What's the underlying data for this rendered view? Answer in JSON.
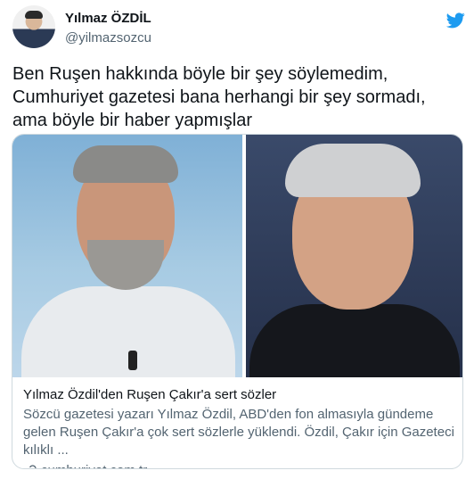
{
  "author": {
    "display_name": "Yılmaz ÖZDİL",
    "handle": "@yilmazsozcu"
  },
  "tweet": {
    "text": "Ben Ruşen hakkında böyle bir şey söylemedim, Cumhuriyet gazetesi bana herhangi bir şey sormadı, ama böyle bir haber yapmışlar"
  },
  "card": {
    "title": "Yılmaz Özdil'den Ruşen Çakır'a sert sözler",
    "description": "Sözcü gazetesi yazarı Yılmaz Özdil, ABD'den fon almasıyla gündeme gelen Ruşen Çakır'a çok sert sözlerle yüklendi. Özdil, Çakır için Gazeteci kılıklı ...",
    "domain": "cumhuriyet.com.tr"
  },
  "icons": {
    "brand": "twitter-bird-icon",
    "link": "link-icon"
  },
  "colors": {
    "brand": "#1d9bf0",
    "text": "#0f1419",
    "secondary": "#536471",
    "border": "#cfd9de"
  }
}
